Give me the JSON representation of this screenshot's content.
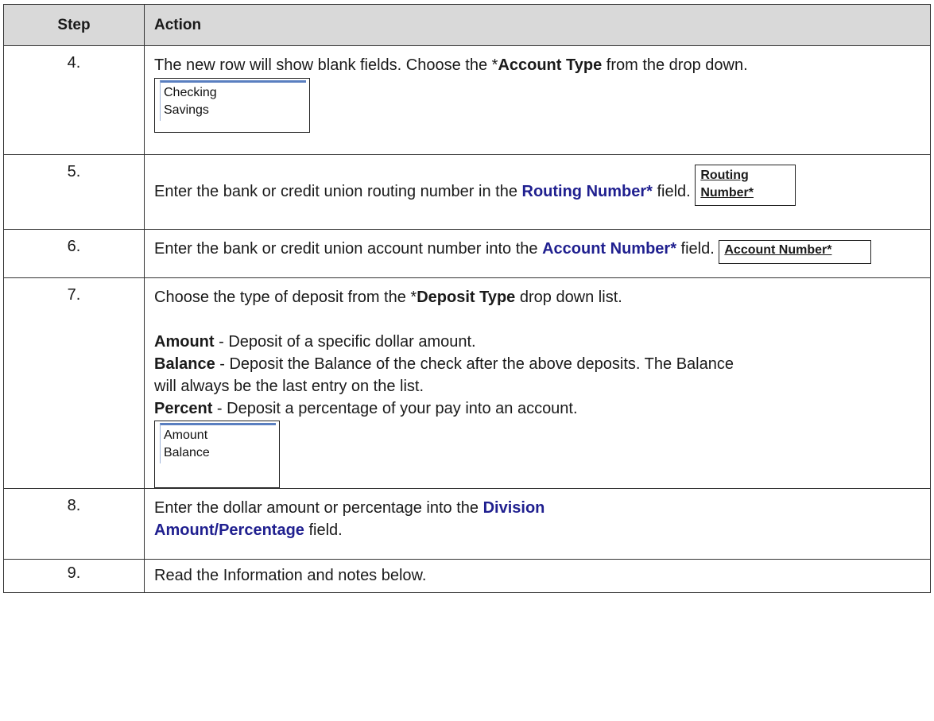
{
  "header": {
    "step": "Step",
    "action": "Action"
  },
  "rows": [
    {
      "step": "4.",
      "text_a": "The new row will show blank fields.  Choose the *",
      "bold_a": "Account Type",
      "text_b": " from the drop down.",
      "listbox": [
        "Checking",
        "Savings"
      ]
    },
    {
      "step": "5.",
      "text_a": "Enter the bank or credit union routing number in the ",
      "blue_a": "Routing Number*",
      "text_b": " field.",
      "label_lines": [
        "Routing",
        "Number*"
      ]
    },
    {
      "step": "6.",
      "text_a": "Enter the bank or credit union account number into the ",
      "blue_a": "Account Number*",
      "text_b": " field.",
      "label": "Account Number*"
    },
    {
      "step": "7.",
      "text_a": "Choose the type of deposit from the *",
      "bold_a": "Deposit Type",
      "text_b": " drop down list.",
      "amount_term": "Amount",
      "amount_desc": " - Deposit of a specific dollar amount.",
      "balance_term": "Balance",
      "balance_desc_1": " - Deposit the Balance of the check after the above deposits.  The Balance",
      "balance_desc_2": "will always be the last entry on the list.",
      "percent_term": "Percent",
      "percent_desc": " - Deposit a percentage of your pay into an account.",
      "listbox": [
        "Amount",
        "Balance"
      ]
    },
    {
      "step": "8.",
      "text_a": "Enter the dollar amount or percentage into the ",
      "blue_a": "Division",
      "blue_b": "Amount/Percentage",
      "text_b": " field."
    },
    {
      "step": "9.",
      "text_a": "Read the Information and notes below."
    }
  ]
}
